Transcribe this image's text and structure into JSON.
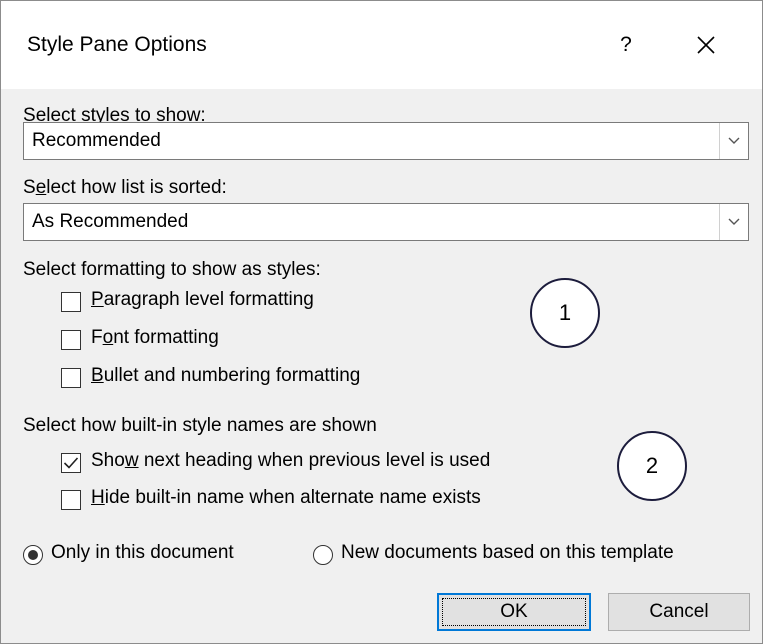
{
  "window": {
    "title": "Style Pane Options",
    "help_label": "?",
    "close_icon": "close-icon"
  },
  "styles_to_show": {
    "label_prefix": "",
    "label_accel": "S",
    "label_rest": "elect styles to show:",
    "value": "Recommended"
  },
  "sort_order": {
    "label_prefix": "S",
    "label_accel": "e",
    "label_rest": "lect how list is sorted:",
    "value": "As Recommended"
  },
  "formatting": {
    "label": "Select formatting to show as styles:",
    "options": [
      {
        "prefix": "",
        "accel": "P",
        "rest": "aragraph level formatting",
        "checked": false
      },
      {
        "prefix": "F",
        "accel": "o",
        "rest": "nt formatting",
        "checked": false
      },
      {
        "prefix": "",
        "accel": "B",
        "rest": "ullet and numbering formatting",
        "checked": false
      }
    ]
  },
  "builtin_names": {
    "label": "Select how built-in style names are shown",
    "options": [
      {
        "prefix": "Sho",
        "accel": "w",
        "rest": " next heading when previous level is used",
        "checked": true
      },
      {
        "prefix": "",
        "accel": "H",
        "rest": "ide built-in name when alternate name exists",
        "checked": false
      }
    ]
  },
  "scope": {
    "options": [
      {
        "label": "Only in this document",
        "selected": true
      },
      {
        "label": "New documents based on this template",
        "selected": false
      }
    ]
  },
  "callouts": [
    "1",
    "2"
  ],
  "buttons": {
    "ok": "OK",
    "cancel": "Cancel"
  }
}
